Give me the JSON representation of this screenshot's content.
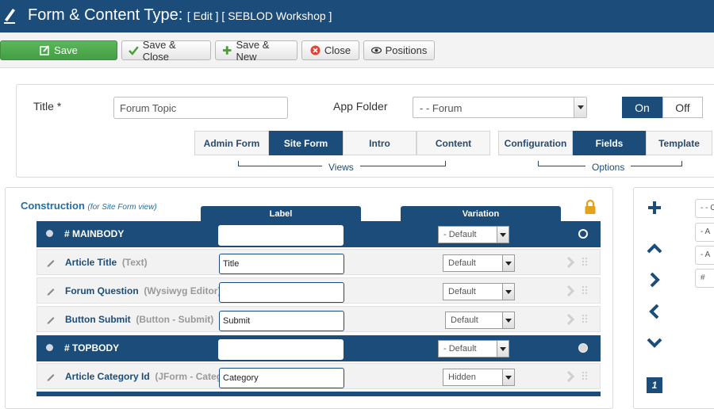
{
  "header": {
    "title": "Form & Content Type:",
    "subtitle": "[ Edit ] [ SEBLOD Workshop ]",
    "logo_icon": "pen-icon"
  },
  "toolbar": {
    "save": "Save",
    "save_close": "Save & Close",
    "save_new": "Save & New",
    "close": "Close",
    "positions": "Positions"
  },
  "form": {
    "title_label": "Title",
    "title_required_mark": "*",
    "title_value": "Forum Topic",
    "app_folder_label": "App Folder",
    "app_folder_value": "- - Forum",
    "toggle_on": "On",
    "toggle_off": "Off"
  },
  "views": {
    "caption": "Views",
    "tabs": [
      "Admin Form",
      "Site Form",
      "Intro",
      "Content"
    ],
    "active": "Site Form"
  },
  "options": {
    "caption": "Options",
    "tabs": [
      "Configuration",
      "Fields",
      "Template"
    ],
    "active": "Fields"
  },
  "construction": {
    "title": "Construction",
    "subtitle": "(for Site Form view)",
    "col_label": "Label",
    "col_variation": "Variation",
    "rows": [
      {
        "kind": "group",
        "name": "# MAINBODY",
        "label": "",
        "variation": "- Default"
      },
      {
        "kind": "field",
        "name": "Article Title",
        "type": "(Text)",
        "label": "Title",
        "variation": "Default"
      },
      {
        "kind": "field",
        "name": "Forum Question",
        "type": "(Wysiwyg Editor)",
        "label": "",
        "variation": "Default"
      },
      {
        "kind": "field",
        "name": "Button Submit",
        "type": "(Button - Submit)",
        "label": "Submit",
        "variation": "Default"
      },
      {
        "kind": "group",
        "name": "# TOPBODY",
        "label": "",
        "variation": "- Default"
      },
      {
        "kind": "field",
        "name": "Article Category Id",
        "type": "(JForm - Categ",
        "label": "Category",
        "variation": "Hidden"
      }
    ]
  },
  "side": {
    "mini_fields": [
      "- - C",
      "- A",
      "- A",
      "#"
    ],
    "page": "1"
  },
  "colors": {
    "brand": "#1c4d7a",
    "save": "#5cb85c",
    "lock": "#e3a21a",
    "link": "#1f6ea8"
  }
}
